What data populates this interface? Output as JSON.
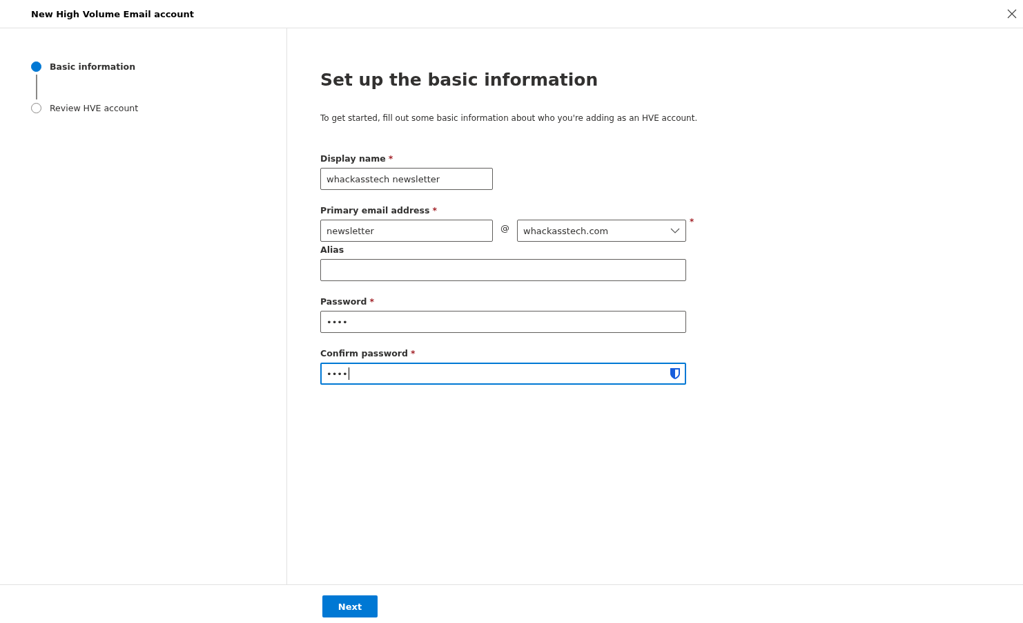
{
  "window": {
    "title": "New High Volume Email account"
  },
  "steps": [
    {
      "label": "Basic information",
      "selected": true
    },
    {
      "label": "Review HVE account",
      "selected": false
    }
  ],
  "heading": "Set up the basic information",
  "description": "To get started, fill out some basic information about who you're adding as an HVE account.",
  "fields": [
    {
      "kind": "text",
      "label": "Display name",
      "required_mark": "*",
      "value": "whackasstech newsletter",
      "focused": false
    },
    {
      "kind": "email",
      "label": "Primary email address",
      "required_mark": "*",
      "value": "newsletter",
      "separator": "@",
      "domain": "whackasstech.com",
      "domain_required_mark": "*",
      "focused": false
    },
    {
      "kind": "wide",
      "label": "Alias",
      "focused": false
    },
    {
      "kind": "wide",
      "label": "Password",
      "required_mark": "*",
      "value": "••••",
      "focused": false
    },
    {
      "kind": "wide",
      "label": "Confirm password",
      "required_mark": "*",
      "value": "••••",
      "focused": true,
      "password_manager": true
    }
  ],
  "buttons": [
    {
      "label": "Next"
    }
  ]
}
